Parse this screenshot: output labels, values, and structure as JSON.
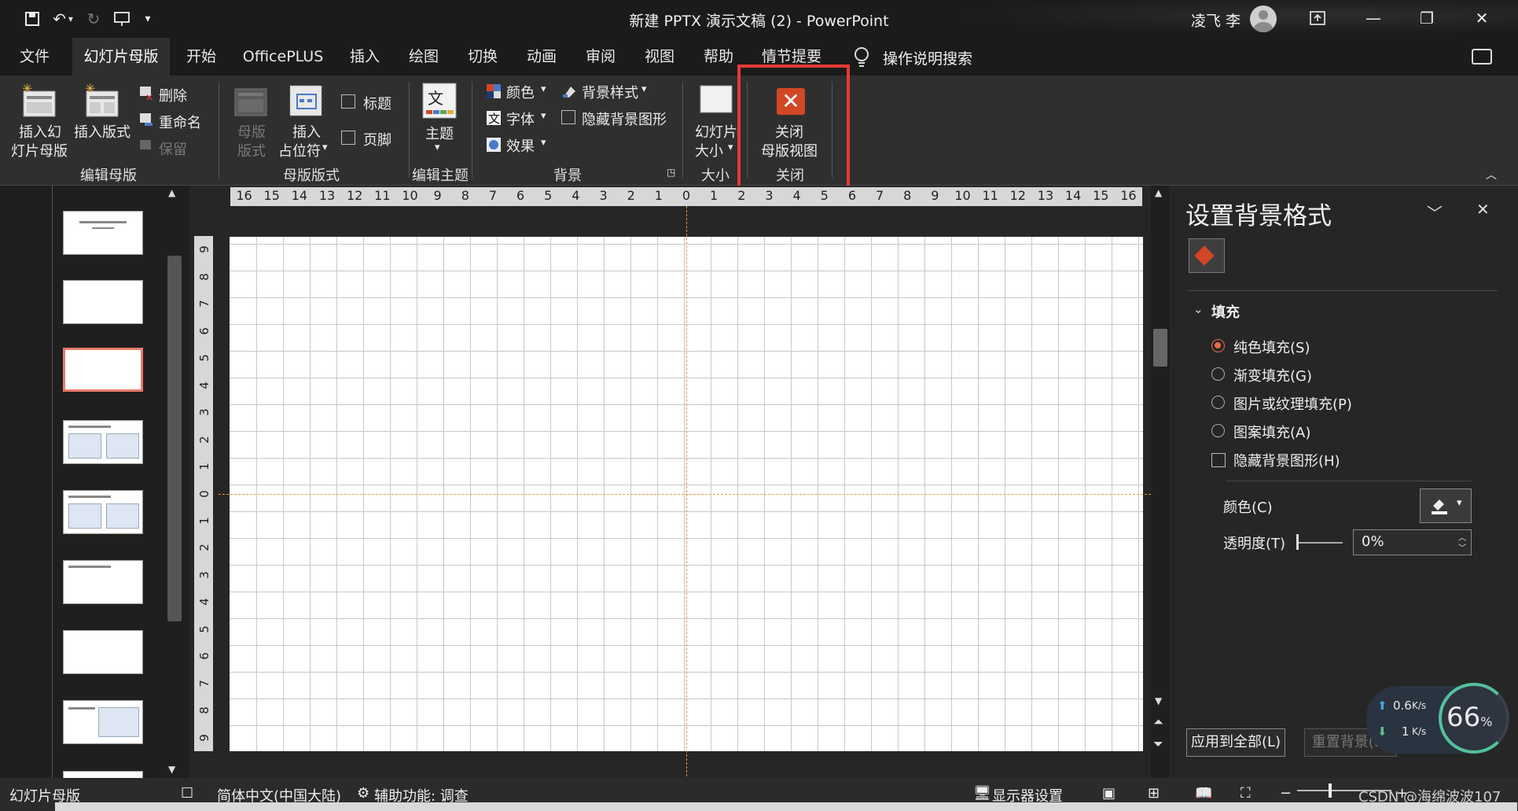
{
  "window": {
    "title": "新建 PPTX 演示文稿 (2)  -  PowerPoint",
    "user_name": "凌飞 李"
  },
  "menu": {
    "tabs": [
      "文件",
      "幻灯片母版",
      "开始",
      "OfficePLUS",
      "插入",
      "绘图",
      "切换",
      "动画",
      "审阅",
      "视图",
      "帮助",
      "情节提要"
    ],
    "active_tab": "幻灯片母版",
    "search": "操作说明搜索"
  },
  "ribbon": {
    "edit_master": {
      "insert_master_1": "插入幻",
      "insert_master_2": "灯片母版",
      "insert_layout": "插入版式",
      "delete": "删除",
      "rename": "重命名",
      "preserve": "保留",
      "label": "编辑母版"
    },
    "master_layout": {
      "master_layout_1": "母版",
      "master_layout_2": "版式",
      "insert_placeholder_1": "插入",
      "insert_placeholder_2": "占位符",
      "title": "标题",
      "footer": "页脚",
      "label": "母版版式"
    },
    "edit_theme": {
      "themes": "主题",
      "label": "编辑主题"
    },
    "background": {
      "colors": "颜色",
      "fonts": "字体",
      "effects": "效果",
      "bg_styles": "背景样式",
      "hide_bg": "隐藏背景图形",
      "label": "背景"
    },
    "size": {
      "slide_size_1": "幻灯片",
      "slide_size_2": "大小",
      "label": "大小"
    },
    "close": {
      "close_1": "关闭",
      "close_2": "母版视图",
      "label": "关闭"
    }
  },
  "ruler": {
    "horizontal": [
      "16",
      "15",
      "14",
      "13",
      "12",
      "11",
      "10",
      "9",
      "8",
      "7",
      "6",
      "5",
      "4",
      "3",
      "2",
      "1",
      "0",
      "1",
      "2",
      "3",
      "4",
      "5",
      "6",
      "7",
      "8",
      "9",
      "10",
      "11",
      "12",
      "13",
      "14",
      "15",
      "16"
    ],
    "vertical": [
      "9",
      "8",
      "7",
      "6",
      "5",
      "4",
      "3",
      "2",
      "1",
      "0",
      "1",
      "2",
      "3",
      "4",
      "5",
      "6",
      "7",
      "8",
      "9"
    ]
  },
  "format_pane": {
    "title": "设置背景格式",
    "section": "填充",
    "options": [
      "纯色填充(S)",
      "渐变填充(G)",
      "图片或纹理填充(P)",
      "图案填充(A)"
    ],
    "selected_option": "纯色填充(S)",
    "hide_bg_graphics": "隐藏背景图形(H)",
    "color_label": "颜色(C)",
    "transparency_label": "透明度(T)",
    "transparency_value": "0%",
    "apply_all": "应用到全部(L)",
    "reset_bg": "重置背景(B)"
  },
  "net_widget": {
    "up": "0.6",
    "up_unit": "K/s",
    "down": "1",
    "down_unit": "K/s",
    "percent": "66",
    "percent_sign": "%"
  },
  "status": {
    "view": "幻灯片母版",
    "language": "简体中文(中国大陆)",
    "accessibility": "辅助功能: 调查",
    "display_settings": "显示器设置",
    "watermark": "CSDN @海绵波波107"
  },
  "colors": {
    "accent": "#d24726",
    "highlight": "#e53935",
    "guide": "#e6953f"
  }
}
